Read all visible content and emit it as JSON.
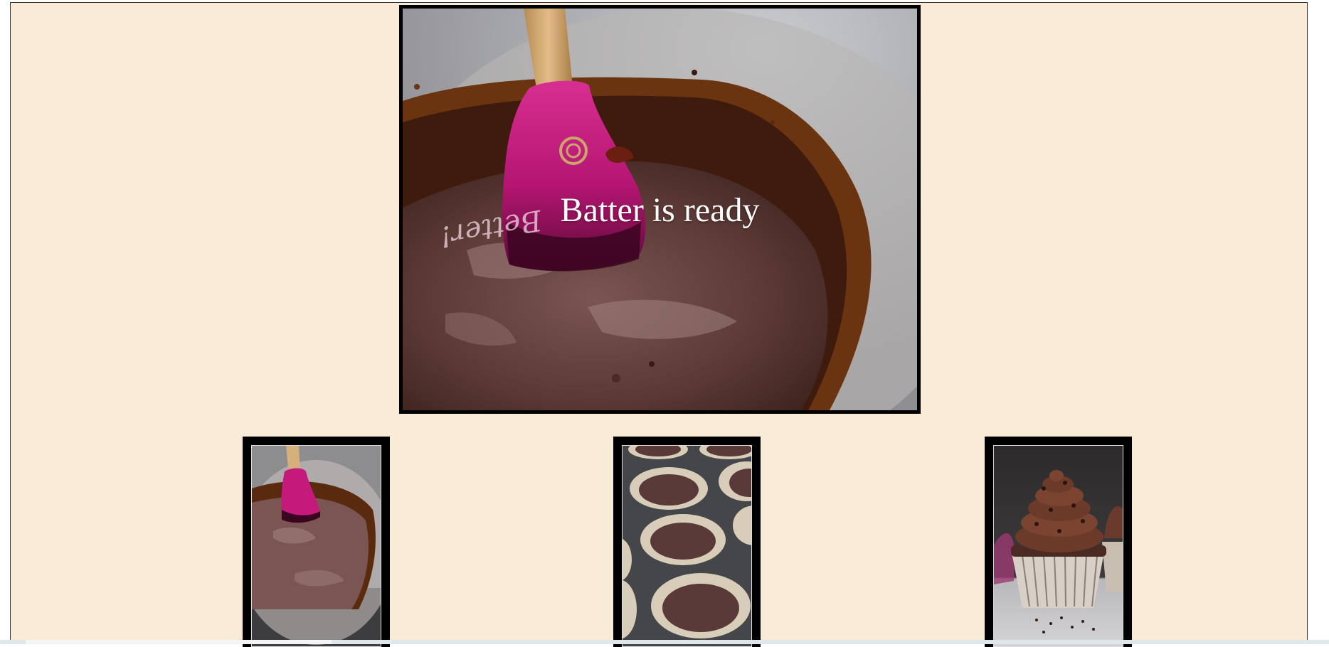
{
  "gallery": {
    "caption": "Batter is ready",
    "featured": {
      "subject": "spatula in chocolate batter bowl",
      "alt": ""
    },
    "thumbnails": [
      {
        "subject": "spatula in chocolate batter bowl",
        "alt": ""
      },
      {
        "subject": "batter in cupcake tin",
        "alt": ""
      },
      {
        "subject": "frosted chocolate cupcake",
        "alt": ""
      }
    ]
  },
  "colors": {
    "page_background": "#faebd7",
    "frame": "#000000",
    "caption": "#ffffff",
    "spatula": "#c41a7c",
    "batter": "#5a3530"
  }
}
